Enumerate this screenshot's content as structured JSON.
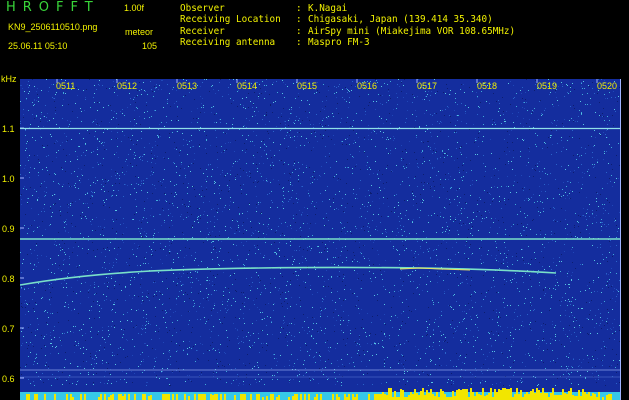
{
  "header": {
    "app_title": "HROFFT",
    "version": "1.00f",
    "filename": "KN9_2506110510.png",
    "mode_label": "meteor",
    "datetime": "25.06.11 05:10",
    "count": "105"
  },
  "info": [
    {
      "key": "Observer",
      "sep": ":",
      "value": "K.Nagai"
    },
    {
      "key": "Receiving Location",
      "sep": ":",
      "value": "Chigasaki, Japan (139.414 35.340)"
    },
    {
      "key": "Receiver",
      "sep": ":",
      "value": "AirSpy mini (Miakejima VOR 108.65MHz)"
    },
    {
      "key": "Receiving antenna",
      "sep": ":",
      "value": "Maspro FM-3"
    }
  ],
  "axis": {
    "y_unit": "kHz",
    "y_ticks": [
      "1.1",
      "1.0",
      "0.9",
      "0.8",
      "0.7",
      "0.6"
    ],
    "x_ticks": [
      "0511",
      "0512",
      "0513",
      "0514",
      "0515",
      "0516",
      "0517",
      "0518",
      "0519",
      "0520"
    ]
  },
  "colors": {
    "background": "#000000",
    "text": "#f2f200",
    "title": "#39d63a",
    "spectrogram_bg": "#142d9e",
    "signal": "#79e0c8"
  }
}
